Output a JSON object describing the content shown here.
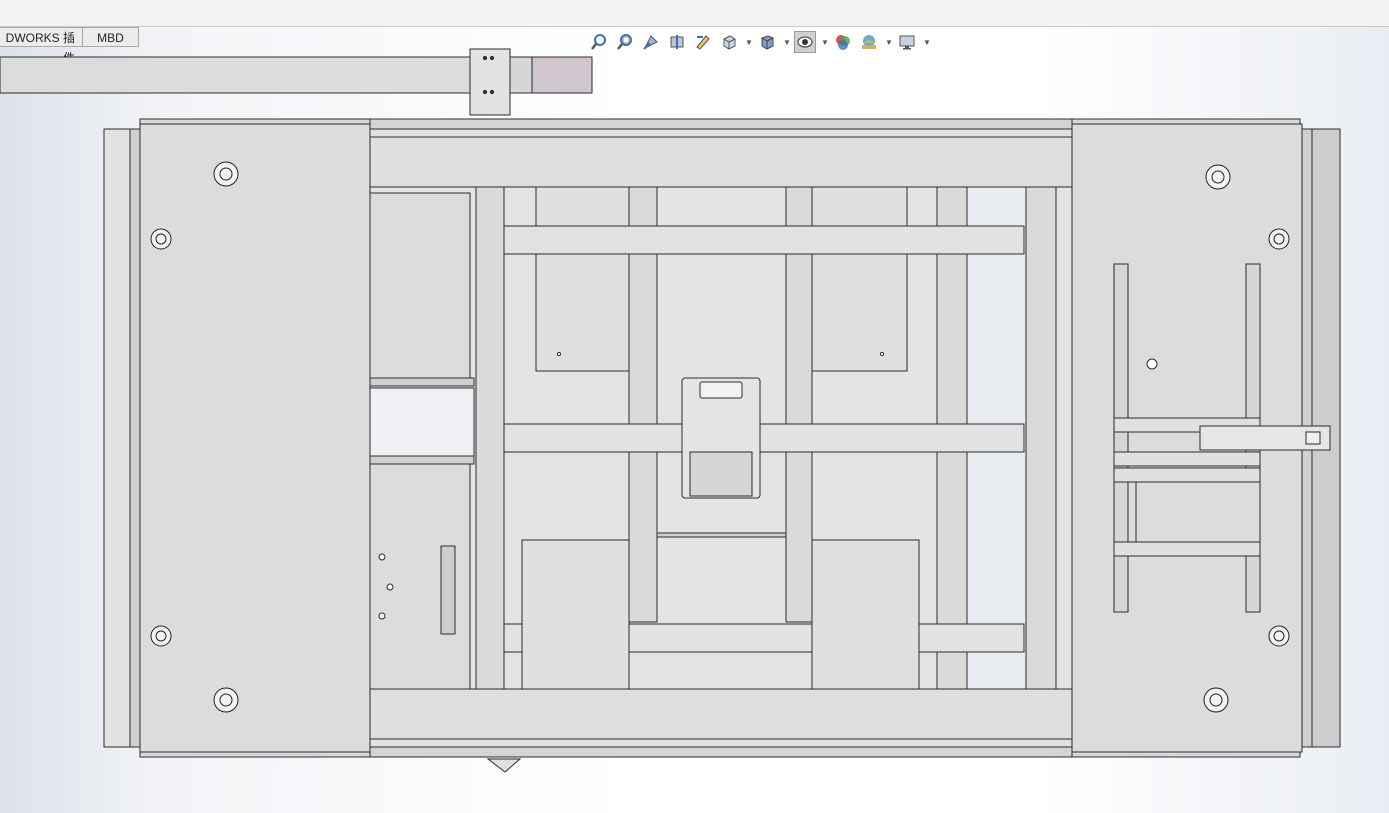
{
  "tabs": [
    {
      "label": "DWORKS 插件"
    },
    {
      "label": "MBD"
    }
  ],
  "toolbar": {
    "icons": [
      "zoom-to-fit-icon",
      "zoom-area-icon",
      "previous-view-icon",
      "section-view-icon",
      "dynamic-annotation-icon",
      "view-orientation-icon",
      "display-style-icon",
      "hide-show-items-icon",
      "edit-appearance-icon",
      "apply-scene-icon",
      "view-settings-icon"
    ],
    "colors": {
      "icon_blue": "#3d6fb3",
      "icon_gray": "#6f6f6f",
      "active_bg": "#cfcfcf"
    }
  },
  "model": {
    "colors": {
      "panel": "#dcdcdc",
      "panel_light": "#e6e6e6",
      "frame": "#d2d2d2",
      "edge": "#2b2b2b",
      "shadow": "#bdbdbd",
      "accent": "#c8bcc8"
    }
  }
}
